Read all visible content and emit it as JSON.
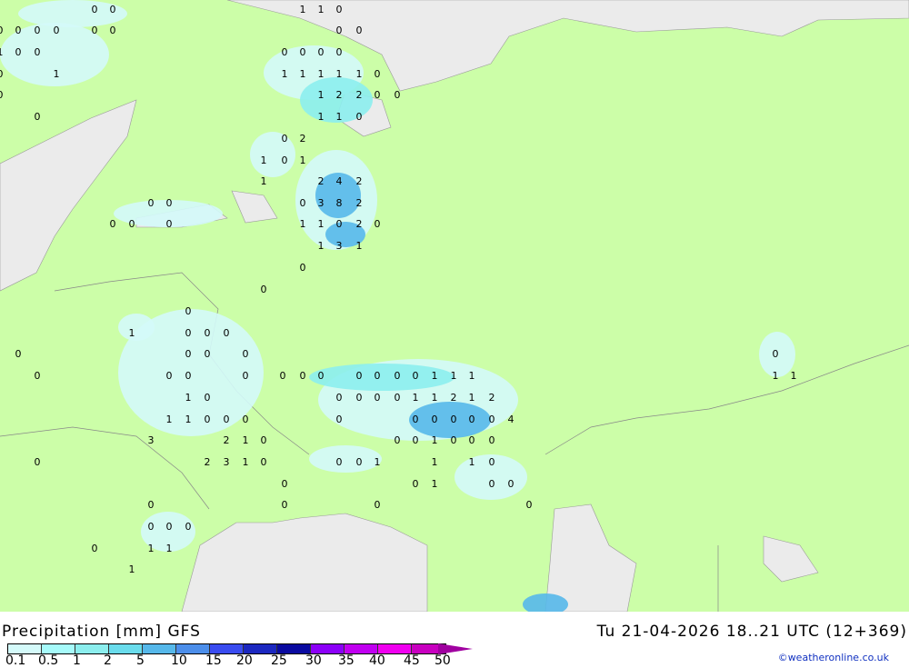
{
  "title": "Precipitation [mm] GFS",
  "datetime": "Tu 21-04-2026 18..21 UTC (12+369)",
  "credit": "©weatheronline.co.uk",
  "legend": {
    "ticks": [
      "0.1",
      "0.5",
      "1",
      "2",
      "5",
      "10",
      "15",
      "20",
      "25",
      "30",
      "35",
      "40",
      "45",
      "50"
    ],
    "colors": [
      "#d4fafa",
      "#a6fafa",
      "#8ceeee",
      "#6adcec",
      "#56b8ea",
      "#4c8eea",
      "#3a4cf0",
      "#1c28c0",
      "#0a0aa0",
      "#8c00f8",
      "#c000f0",
      "#f000f0",
      "#c800c0",
      "#a000a0"
    ]
  },
  "colors": {
    "land": "#ccfea8",
    "water": "#ebebeb",
    "precip_light": "#d4fafa",
    "precip_mid": "#8ceeee",
    "precip_high": "#56b8ea"
  },
  "labels": [
    "0",
    "0",
    "1",
    "1",
    "0",
    "0",
    "0",
    "0",
    "0",
    "0",
    "0",
    "0",
    "0",
    "1",
    "0",
    "0",
    "0",
    "0",
    "0",
    "0",
    "0",
    "1",
    "1",
    "1",
    "1",
    "1",
    "1",
    "0",
    "0",
    "1",
    "2",
    "2",
    "0",
    "0",
    "0",
    "1",
    "1",
    "0",
    "0",
    "2",
    "1",
    "0",
    "1",
    "1",
    "2",
    "4",
    "2",
    "0",
    "3",
    "8",
    "2",
    "0",
    "0",
    "1",
    "1",
    "0",
    "2",
    "0",
    "0",
    "0",
    "0",
    "1",
    "3",
    "1",
    "0",
    "0",
    "0",
    "1",
    "0",
    "0",
    "0",
    "0",
    "0",
    "0",
    "0",
    "0",
    "0",
    "0",
    "0",
    "0",
    "0",
    "0",
    "0",
    "0",
    "0",
    "0",
    "0",
    "1",
    "1",
    "1",
    "1",
    "1",
    "1",
    "0",
    "0",
    "0",
    "0",
    "0",
    "1",
    "1",
    "2",
    "1",
    "2",
    "1",
    "1",
    "0",
    "0",
    "0",
    "0",
    "0",
    "0",
    "0",
    "0",
    "0",
    "4",
    "3",
    "2",
    "1",
    "0",
    "0",
    "0",
    "1",
    "0",
    "0",
    "0",
    "0",
    "2",
    "3",
    "1",
    "0",
    "0",
    "0",
    "1",
    "1",
    "1",
    "0",
    "0",
    "0",
    "1",
    "0",
    "0",
    "0",
    "0",
    "0",
    "0",
    "0",
    "0",
    "0",
    "0",
    "1",
    "1",
    "1",
    "0",
    "0",
    "0",
    "0"
  ]
}
